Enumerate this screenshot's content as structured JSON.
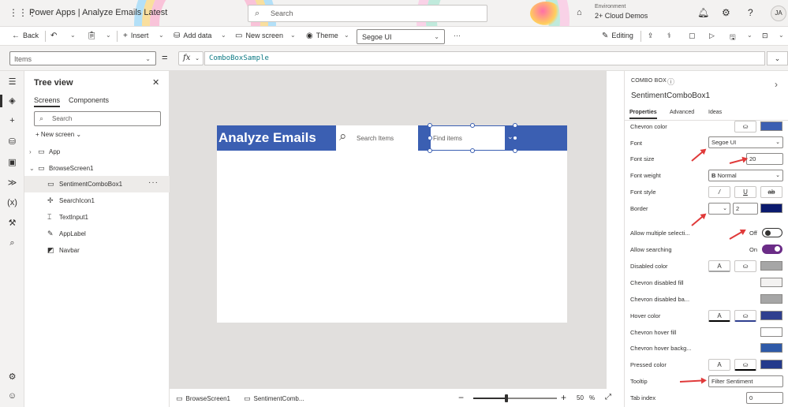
{
  "header": {
    "app_name": "Power Apps",
    "separator": "|",
    "app_title": "Analyze Emails Latest",
    "search_placeholder": "Search",
    "environment_label": "Environment",
    "environment_name": "2+ Cloud Demos",
    "user_initials": "JA",
    "icons": [
      "waffle-icon",
      "search-icon",
      "environment-icon",
      "bell-icon",
      "gear-icon",
      "help-icon"
    ]
  },
  "commandbar": {
    "back": "Back",
    "insert": "Insert",
    "add_data": "Add data",
    "new_screen": "New screen",
    "theme": "Theme",
    "font": "Segoe UI",
    "more": "···",
    "editing": "Editing"
  },
  "formula": {
    "property": "Items",
    "equals": "=",
    "fx": "fx",
    "value": "ComboBoxSample"
  },
  "tree": {
    "title": "Tree view",
    "tabs": [
      "Screens",
      "Components"
    ],
    "search_placeholder": "Search",
    "new_screen": "New screen",
    "nodes": [
      {
        "label": "App"
      },
      {
        "label": "BrowseScreen1"
      },
      {
        "label": "SentimentComboBox1"
      },
      {
        "label": "SearchIcon1"
      },
      {
        "label": "TextInput1"
      },
      {
        "label": "AppLabel"
      },
      {
        "label": "Navbar"
      }
    ],
    "more": "···"
  },
  "canvas": {
    "app_label": "Analyze Emails",
    "search_placeholder": "Search Items",
    "combo_placeholder": "Find items",
    "breadcrumbs": [
      "BrowseScreen1",
      "SentimentComb..."
    ],
    "zoom": "50",
    "zoom_unit": "%",
    "zoom_fraction": 0.4,
    "navbar_color": "#3b5fb2"
  },
  "properties": {
    "control_type": "COMBO BOX",
    "control_name": "SentimentComboBox1",
    "tabs": [
      "Properties",
      "Advanced",
      "Ideas"
    ],
    "rows": {
      "chevron_color": "Chevron color",
      "font": "Font",
      "font_value": "Segoe UI",
      "font_size": "Font size",
      "font_size_value": "20",
      "font_weight": "Font weight",
      "font_weight_value": "Normal",
      "font_weight_glyph": "B",
      "font_style": "Font style",
      "border": "Border",
      "border_value": "2",
      "allow_multiple": "Allow multiple selecti...",
      "allow_multiple_state": "Off",
      "allow_searching": "Allow searching",
      "allow_searching_state": "On",
      "disabled_color": "Disabled color",
      "chevron_disabled_fill": "Chevron disabled fill",
      "chevron_disabled_back": "Chevron disabled ba...",
      "hover_color": "Hover color",
      "chevron_hover_fill": "Chevron hover fill",
      "chevron_hover_back": "Chevron hover backg...",
      "pressed_color": "Pressed color",
      "tooltip": "Tooltip",
      "tooltip_value": "Filter Sentiment",
      "tab_index": "Tab index",
      "tab_index_value": "0"
    },
    "colors": {
      "chevron": "#3b5fb2",
      "border": "#0b1a6e",
      "disabled": "#a6a6a6",
      "chevron_disabled_fill": "#f3f2f1",
      "chevron_disabled_back": "#a6a6a6",
      "hover": "#2f3f8f",
      "chevron_hover_fill": "#ffffff",
      "chevron_hover_back": "#2f5aa8",
      "pressed": "#243a8c",
      "toggle_on": "#6b2c87"
    }
  }
}
